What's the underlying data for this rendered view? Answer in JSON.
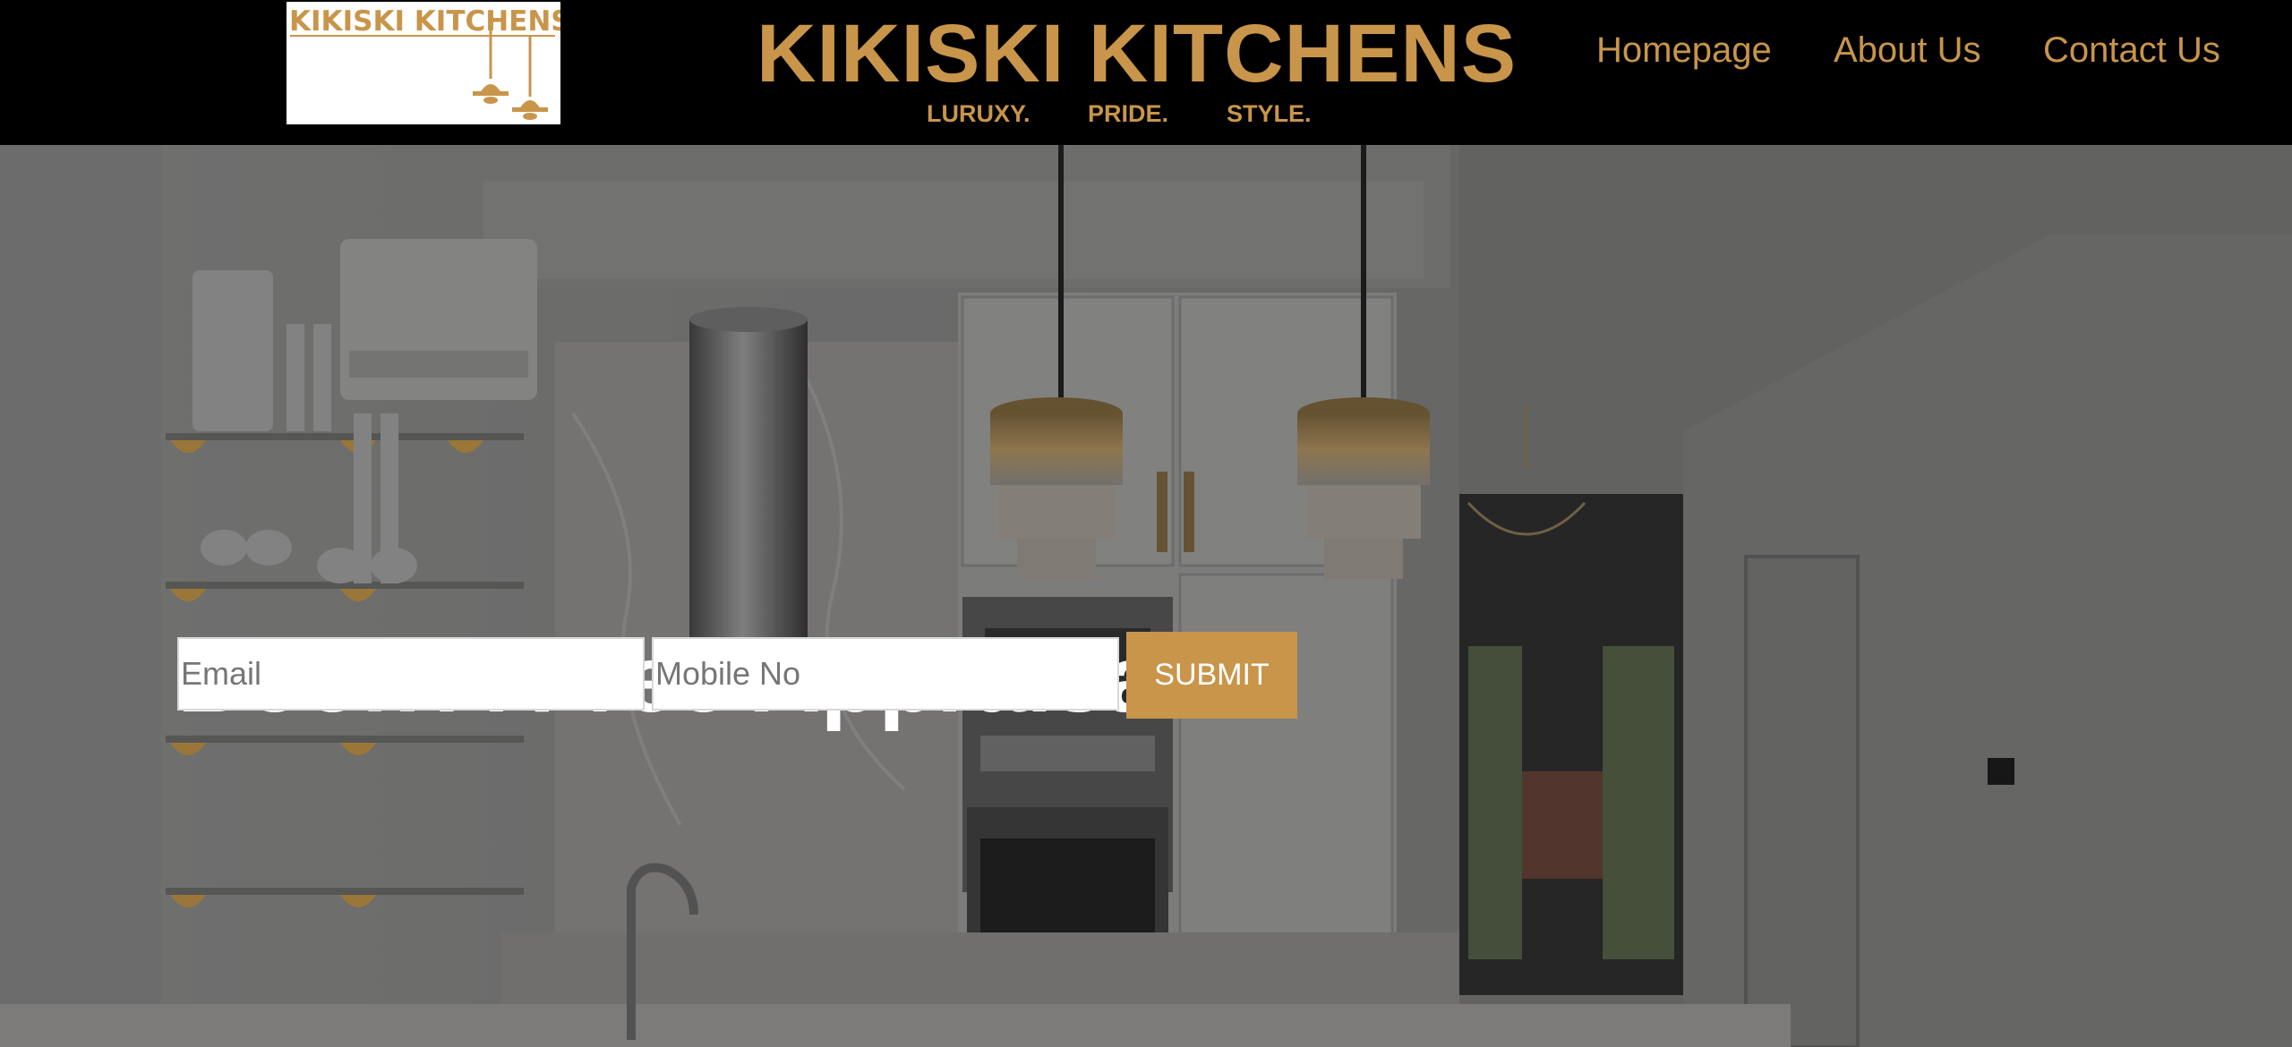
{
  "header": {
    "logo_text": "KIKISKI KITCHENS",
    "brand_title": "KIKISKI KITCHENS",
    "tagline": [
      "LURUXY.",
      "PRIDE.",
      "STYLE."
    ],
    "nav": [
      "Homepage",
      "About Us",
      "Contact Us"
    ]
  },
  "hero": {
    "title": "Book A Free Appraisal",
    "email_placeholder": "Email",
    "mobile_placeholder": "Mobile No",
    "submit_label": "SUBMIT"
  },
  "colors": {
    "accent_gold": "#c8954a",
    "header_bg": "#000000",
    "hero_title": "#ffffff"
  },
  "icons": {
    "logo_lamps": "pendant-lamp-icon"
  }
}
